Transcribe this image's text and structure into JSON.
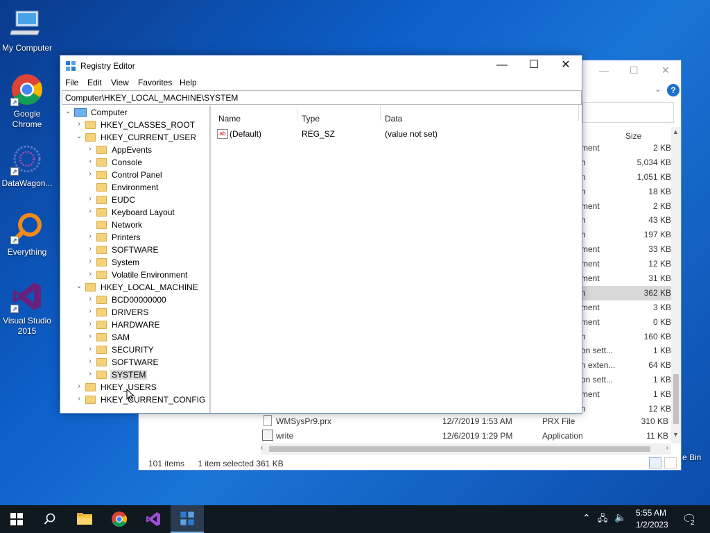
{
  "desktop": {
    "icons": [
      {
        "label": "My Computer"
      },
      {
        "label": "Google Chrome"
      },
      {
        "label": "DataWagon..."
      },
      {
        "label": "Everything"
      },
      {
        "label": "Visual Studio 2015"
      }
    ],
    "recycle_bin_label": "e Bin"
  },
  "explorer": {
    "col_size": "Size",
    "rows": [
      {
        "type": "ment",
        "size": "2 KB"
      },
      {
        "type": "n",
        "size": "5,034 KB"
      },
      {
        "type": "n",
        "size": "1,051 KB"
      },
      {
        "type": "n",
        "size": "18 KB"
      },
      {
        "type": "ment",
        "size": "2 KB"
      },
      {
        "type": "n",
        "size": "43 KB"
      },
      {
        "type": "n",
        "size": "197 KB"
      },
      {
        "type": "ment",
        "size": "33 KB"
      },
      {
        "type": "ment",
        "size": "12 KB"
      },
      {
        "type": "ment",
        "size": "31 KB"
      },
      {
        "type": "n",
        "size": "362 KB"
      },
      {
        "type": "ment",
        "size": "3 KB"
      },
      {
        "type": "ment",
        "size": "0 KB"
      },
      {
        "type": "n",
        "size": "160 KB"
      },
      {
        "type": "on sett...",
        "size": "1 KB"
      },
      {
        "type": "n exten...",
        "size": "64 KB"
      },
      {
        "type": "on sett...",
        "size": "1 KB"
      },
      {
        "type": "ment",
        "size": "1 KB"
      },
      {
        "type": "n",
        "size": "12 KB"
      }
    ],
    "lower_rows": [
      {
        "name": "WMSysPr9.prx",
        "date": "12/7/2019 1:53 AM",
        "type": "PRX File",
        "size": "310 KB"
      },
      {
        "name": "write",
        "date": "12/6/2019 1:29 PM",
        "type": "Application",
        "size": "11 KB"
      }
    ],
    "status_items": "101 items",
    "status_selected": "1 item selected  361 KB"
  },
  "regedit": {
    "title": "Registry Editor",
    "menu": [
      "File",
      "Edit",
      "View",
      "Favorites",
      "Help"
    ],
    "address": "Computer\\HKEY_LOCAL_MACHINE\\SYSTEM",
    "tree_root": "Computer",
    "tree": [
      {
        "label": "HKEY_CLASSES_ROOT"
      },
      {
        "label": "HKEY_CURRENT_USER"
      },
      {
        "label": "AppEvents"
      },
      {
        "label": "Console"
      },
      {
        "label": "Control Panel"
      },
      {
        "label": "Environment"
      },
      {
        "label": "EUDC"
      },
      {
        "label": "Keyboard Layout"
      },
      {
        "label": "Network"
      },
      {
        "label": "Printers"
      },
      {
        "label": "SOFTWARE"
      },
      {
        "label": "System"
      },
      {
        "label": "Volatile Environment"
      },
      {
        "label": "HKEY_LOCAL_MACHINE"
      },
      {
        "label": "BCD00000000"
      },
      {
        "label": "DRIVERS"
      },
      {
        "label": "HARDWARE"
      },
      {
        "label": "SAM"
      },
      {
        "label": "SECURITY"
      },
      {
        "label": "SOFTWARE"
      },
      {
        "label": "SYSTEM"
      },
      {
        "label": "HKEY_USERS"
      },
      {
        "label": "HKEY_CURRENT_CONFIG"
      }
    ],
    "columns": {
      "name": "Name",
      "type": "Type",
      "data": "Data"
    },
    "values": [
      {
        "name": "(Default)",
        "type": "REG_SZ",
        "data": "(value not set)"
      }
    ]
  },
  "taskbar": {
    "time": "5:55 AM",
    "date": "1/2/2023",
    "notification_count": "2"
  }
}
